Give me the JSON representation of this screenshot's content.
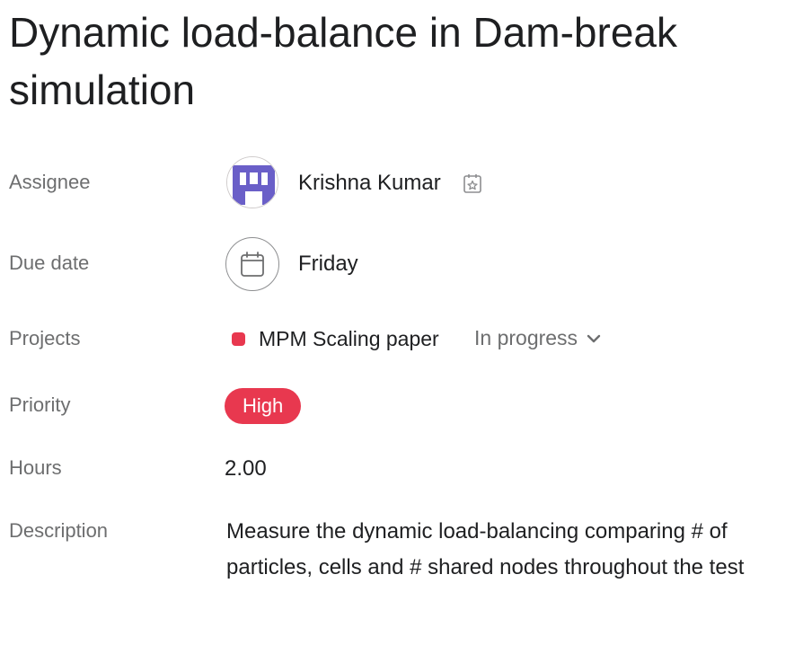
{
  "task": {
    "title": "Dynamic load-balance in Dam-break simulation"
  },
  "fields": {
    "assignee": {
      "label": "Assignee",
      "name": "Krishna Kumar"
    },
    "due_date": {
      "label": "Due date",
      "value": "Friday"
    },
    "projects": {
      "label": "Projects",
      "project_name": "MPM Scaling paper",
      "project_color": "#e8384f",
      "status": "In progress"
    },
    "priority": {
      "label": "Priority",
      "value": "High",
      "color": "#e8384f"
    },
    "hours": {
      "label": "Hours",
      "value": "2.00"
    },
    "description": {
      "label": "Description",
      "text": "Measure the dynamic load-balancing comparing # of particles, cells and # shared nodes throughout the test"
    }
  },
  "icons": {
    "assignee_badge": "star-calendar-icon",
    "due_date": "calendar-icon",
    "status_chevron": "chevron-down-icon"
  }
}
